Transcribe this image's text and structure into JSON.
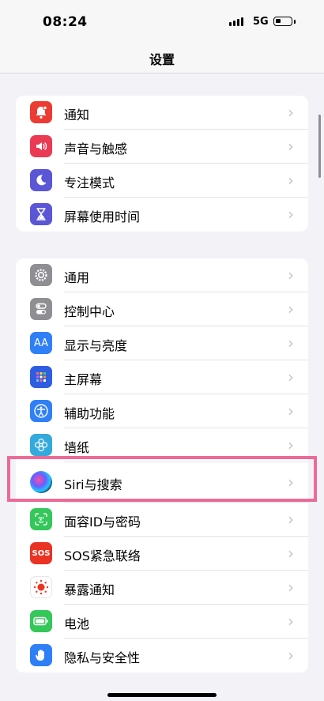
{
  "status_bar": {
    "time": "08:24",
    "network": "5G",
    "battery_level": 0.35,
    "icons": [
      "signal-icon",
      "battery-icon"
    ]
  },
  "nav": {
    "title": "设置"
  },
  "groups": [
    {
      "items": [
        {
          "label": "通知",
          "icon": "bell-icon",
          "color": "#ec3b32"
        },
        {
          "label": "声音与触感",
          "icon": "speaker-icon",
          "color": "#ea3a54"
        },
        {
          "label": "专注模式",
          "icon": "moon-icon",
          "color": "#5a56d6"
        },
        {
          "label": "屏幕使用时间",
          "icon": "hourglass-icon",
          "color": "#5a56d6"
        }
      ]
    },
    {
      "items": [
        {
          "label": "通用",
          "icon": "gear-icon",
          "color": "#8e8e93"
        },
        {
          "label": "控制中心",
          "icon": "toggles-icon",
          "color": "#8e8e93"
        },
        {
          "label": "显示与亮度",
          "icon": "text-size-icon",
          "color": "#2f7ff6"
        },
        {
          "label": "主屏幕",
          "icon": "home-screen-icon",
          "color": "#2f5fe0"
        },
        {
          "label": "辅助功能",
          "icon": "accessibility-icon",
          "color": "#2f7ff6"
        },
        {
          "label": "墙纸",
          "icon": "flower-icon",
          "color": "#34aadc"
        },
        {
          "label": "Siri与搜索",
          "icon": "siri-icon",
          "color": "#1a1a2e"
        },
        {
          "label": "面容ID与密码",
          "icon": "face-id-icon",
          "color": "#34c759"
        },
        {
          "label": "SOS紧急联络",
          "icon": "sos-icon",
          "color": "#ea3323"
        },
        {
          "label": "暴露通知",
          "icon": "exposure-icon",
          "color": "#ffffff"
        },
        {
          "label": "电池",
          "icon": "battery-icon",
          "color": "#34c759"
        },
        {
          "label": "隐私与安全性",
          "icon": "hand-icon",
          "color": "#2f7ff6"
        }
      ]
    }
  ],
  "icon_text": {
    "text_size": "AA",
    "sos": "SOS"
  },
  "highlight": {
    "item": "Siri与搜索",
    "color": "#ee6a96"
  }
}
